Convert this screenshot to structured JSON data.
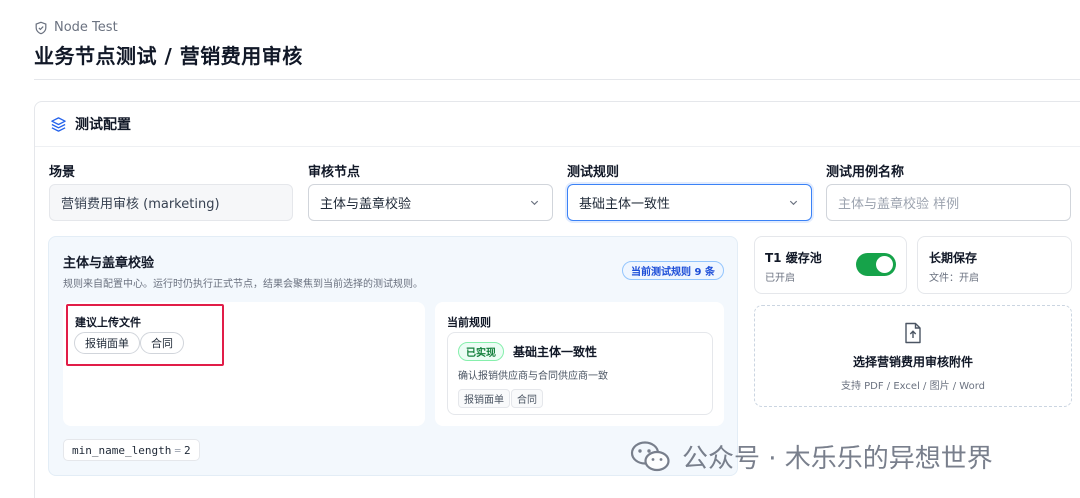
{
  "header": {
    "breadcrumb": "Node Test",
    "title": "业务节点测试 / 营销费用审核"
  },
  "config_card": {
    "title": "测试配置"
  },
  "fields": {
    "scene": {
      "label": "场景",
      "value": "营销费用审核 (marketing)"
    },
    "audit_node": {
      "label": "审核节点",
      "value": "主体与盖章校验"
    },
    "test_rule": {
      "label": "测试规则",
      "value": "基础主体一致性"
    },
    "case_name": {
      "label": "测试用例名称",
      "placeholder": "主体与盖章校验 样例"
    }
  },
  "rules_panel": {
    "title": "主体与盖章校验",
    "description": "规则来自配置中心。运行时仍执行正式节点，结果会聚焦到当前选择的测试规则。",
    "count_badge": "当前测试规则 9 条",
    "suggested": {
      "label": "建议上传文件",
      "chips": [
        "报销面单",
        "合同"
      ]
    },
    "current_rule": {
      "label": "当前规则",
      "status": "已实现",
      "name": "基础主体一致性",
      "desc": "确认报销供应商与合同供应商一致",
      "tags": [
        "报销面单",
        "合同"
      ]
    },
    "param": {
      "key": "min_name_length",
      "eq": "=",
      "value": "2"
    }
  },
  "cache": {
    "title": "T1 缓存池",
    "status": "已开启",
    "enabled": true
  },
  "retention": {
    "title": "长期保存",
    "status": "文件：开启"
  },
  "upload": {
    "title": "选择营销费用审核附件",
    "subtitle": "支持 PDF / Excel / 图片 / Word"
  },
  "watermark": {
    "text": "公众号 · 木乐乐的异想世界"
  },
  "colors": {
    "accent": "#3b82f6",
    "toggle_on": "#16a34a",
    "highlight": "#e11d48"
  }
}
